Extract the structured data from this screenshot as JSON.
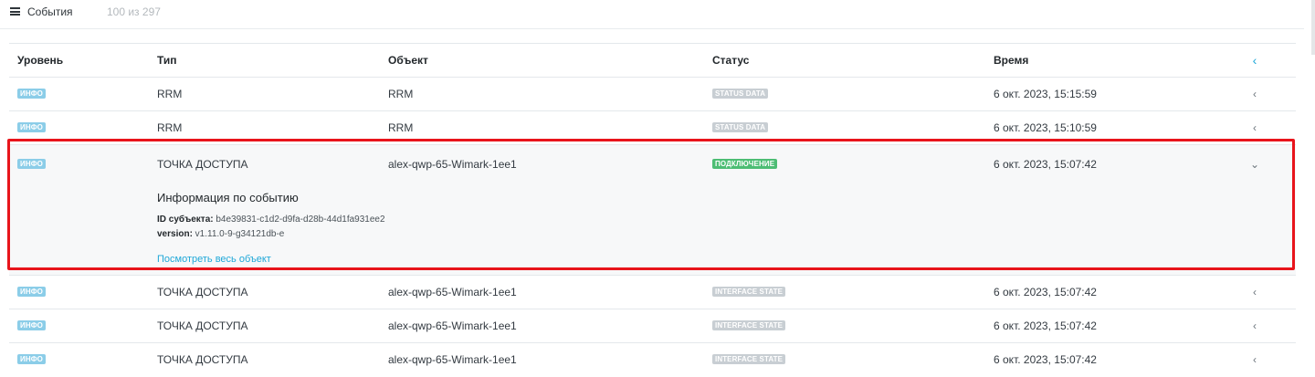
{
  "header": {
    "title": "События",
    "count": "100 из 297"
  },
  "table": {
    "columns": {
      "level": "Уровень",
      "type": "Тип",
      "object": "Объект",
      "status": "Статус",
      "time": "Время",
      "toggle": "‹"
    },
    "rows": [
      {
        "level": "ИНФО",
        "type": "RRM",
        "object": "RRM",
        "status": "STATUS DATA",
        "time": "6 окт. 2023, 15:15:59",
        "toggle": "‹"
      },
      {
        "level": "ИНФО",
        "type": "RRM",
        "object": "RRM",
        "status": "STATUS DATA",
        "time": "6 окт. 2023, 15:10:59",
        "toggle": "‹"
      },
      {
        "level": "ИНФО",
        "type": "ТОЧКА ДОСТУПА",
        "object": "alex-qwp-65-Wimark-1ee1",
        "status": "ПОДКЛЮЧЕНИЕ",
        "time": "6 окт. 2023, 15:07:42",
        "toggle": "⌄"
      },
      {
        "level": "ИНФО",
        "type": "ТОЧКА ДОСТУПА",
        "object": "alex-qwp-65-Wimark-1ee1",
        "status": "INTERFACE STATE",
        "time": "6 окт. 2023, 15:07:42",
        "toggle": "‹"
      },
      {
        "level": "ИНФО",
        "type": "ТОЧКА ДОСТУПА",
        "object": "alex-qwp-65-Wimark-1ee1",
        "status": "INTERFACE STATE",
        "time": "6 окт. 2023, 15:07:42",
        "toggle": "‹"
      },
      {
        "level": "ИНФО",
        "type": "ТОЧКА ДОСТУПА",
        "object": "alex-qwp-65-Wimark-1ee1",
        "status": "INTERFACE STATE",
        "time": "6 окт. 2023, 15:07:42",
        "toggle": "‹"
      }
    ]
  },
  "details": {
    "title": "Информация по событию",
    "subject_id_label": "ID субъекта:",
    "subject_id_value": " b4e39831-c1d2-d9fa-d28b-44d1fa931ee2",
    "version_label": "version:",
    "version_value": " v1.11.0-9-g34121db-e",
    "link": "Посмотреть весь объект"
  },
  "colors": {
    "info_badge": "#8bcde8",
    "status_badge": "#c8ced3",
    "success_badge": "#4dbd74",
    "accent": "#20a8d8",
    "highlight": "#e8141b"
  },
  "icons": {
    "menu": "menu-icon",
    "collapse": "chevron-left-icon",
    "expand": "chevron-down-icon"
  }
}
